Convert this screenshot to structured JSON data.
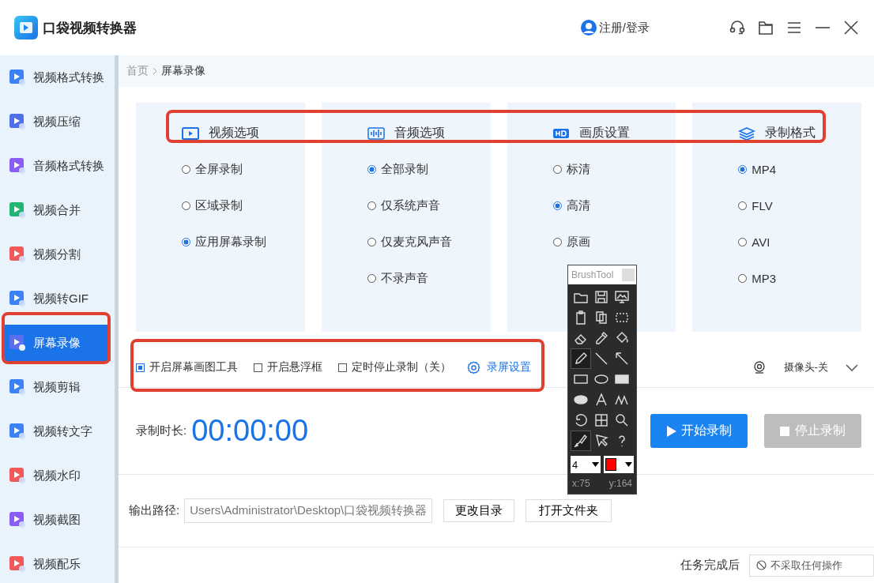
{
  "app": {
    "title": "口袋视频转换器",
    "login": "注册/登录"
  },
  "sidebar": {
    "items": [
      {
        "label": "视频格式转换",
        "color": "#3b82f6",
        "selected": false
      },
      {
        "label": "视频压缩",
        "color": "#4f6ee8",
        "selected": false
      },
      {
        "label": "音频格式转换",
        "color": "#8b5cf6",
        "selected": false
      },
      {
        "label": "视频合并",
        "color": "#22b573",
        "selected": false
      },
      {
        "label": "视频分割",
        "color": "#f05a5a",
        "selected": false
      },
      {
        "label": "视频转GIF",
        "color": "#3b82f6",
        "selected": false
      },
      {
        "label": "屏幕录像",
        "color": "#5b6ef0",
        "selected": true
      },
      {
        "label": "视频剪辑",
        "color": "#3b82f6",
        "selected": false
      },
      {
        "label": "视频转文字",
        "color": "#3b82f6",
        "selected": false
      },
      {
        "label": "视频水印",
        "color": "#f05a5a",
        "selected": false
      },
      {
        "label": "视频截图",
        "color": "#8b5cf6",
        "selected": false
      },
      {
        "label": "视频配乐",
        "color": "#f05a5a",
        "selected": false
      }
    ]
  },
  "breadcrumb": {
    "home": "首页",
    "current": "屏幕录像"
  },
  "option_groups": [
    {
      "kind": "video",
      "title": "视频选项",
      "options": [
        {
          "label": "全屏录制",
          "selected": false
        },
        {
          "label": "区域录制",
          "selected": false
        },
        {
          "label": "应用屏幕录制",
          "selected": true
        }
      ]
    },
    {
      "kind": "audio",
      "title": "音频选项",
      "options": [
        {
          "label": "全部录制",
          "selected": true
        },
        {
          "label": "仅系统声音",
          "selected": false
        },
        {
          "label": "仅麦克风声音",
          "selected": false
        },
        {
          "label": "不录声音",
          "selected": false
        }
      ]
    },
    {
      "kind": "quality",
      "title": "画质设置",
      "options": [
        {
          "label": "标清",
          "selected": false
        },
        {
          "label": "高清",
          "selected": true
        },
        {
          "label": "原画",
          "selected": false
        }
      ]
    },
    {
      "kind": "format",
      "title": "录制格式",
      "options": [
        {
          "label": "MP4",
          "selected": true
        },
        {
          "label": "FLV",
          "selected": false
        },
        {
          "label": "AVI",
          "selected": false
        },
        {
          "label": "MP3",
          "selected": false
        }
      ]
    }
  ],
  "toolbar": {
    "checkboxes": [
      {
        "label": "开启屏幕画图工具",
        "checked": true
      },
      {
        "label": "开启悬浮框",
        "checked": false
      },
      {
        "label": "定时停止录制（关）",
        "checked": false
      }
    ],
    "settings_link": "录屏设置",
    "camera": "摄像头-关"
  },
  "timer": {
    "label": "录制时长:",
    "value": "00:00:00"
  },
  "buttons": [
    {
      "label": "开始录制",
      "disabled": false
    },
    {
      "label": "停止录制",
      "disabled": true
    }
  ],
  "output": {
    "label": "输出路径:",
    "path": "Users\\Administrator\\Desktop\\口袋视频转换器",
    "buttons": [
      "更改目录",
      "打开文件夹"
    ]
  },
  "after_task": {
    "label": "任务完成后",
    "value": "不采取任何操作"
  },
  "brush_tool": {
    "title": "BrushTool",
    "tools": [
      {
        "kind": "folder",
        "selected": false
      },
      {
        "kind": "save",
        "selected": false
      },
      {
        "kind": "monitor",
        "selected": false
      },
      {
        "kind": "clipboard",
        "selected": false
      },
      {
        "kind": "copy",
        "selected": false
      },
      {
        "kind": "selection",
        "selected": false
      },
      {
        "kind": "eraser",
        "selected": false
      },
      {
        "kind": "eyedropper",
        "selected": false
      },
      {
        "kind": "bucket",
        "selected": false
      },
      {
        "kind": "pencil",
        "selected": true
      },
      {
        "kind": "line",
        "selected": false
      },
      {
        "kind": "arrow",
        "selected": false
      },
      {
        "kind": "rectangle",
        "selected": false
      },
      {
        "kind": "ellipse",
        "selected": false
      },
      {
        "kind": "filled_rectangle",
        "selected": false
      },
      {
        "kind": "filled_ellipse",
        "selected": false
      },
      {
        "kind": "text",
        "selected": false
      },
      {
        "kind": "text_size",
        "selected": false
      },
      {
        "kind": "undo",
        "selected": false
      },
      {
        "kind": "grid",
        "selected": false
      },
      {
        "kind": "zoom",
        "selected": false
      },
      {
        "kind": "brush",
        "selected": true
      },
      {
        "kind": "pointer",
        "selected": false
      },
      {
        "kind": "help",
        "selected": false
      }
    ],
    "size": "4",
    "color": "#ff0000",
    "x": "x:75",
    "y": "y:164"
  }
}
